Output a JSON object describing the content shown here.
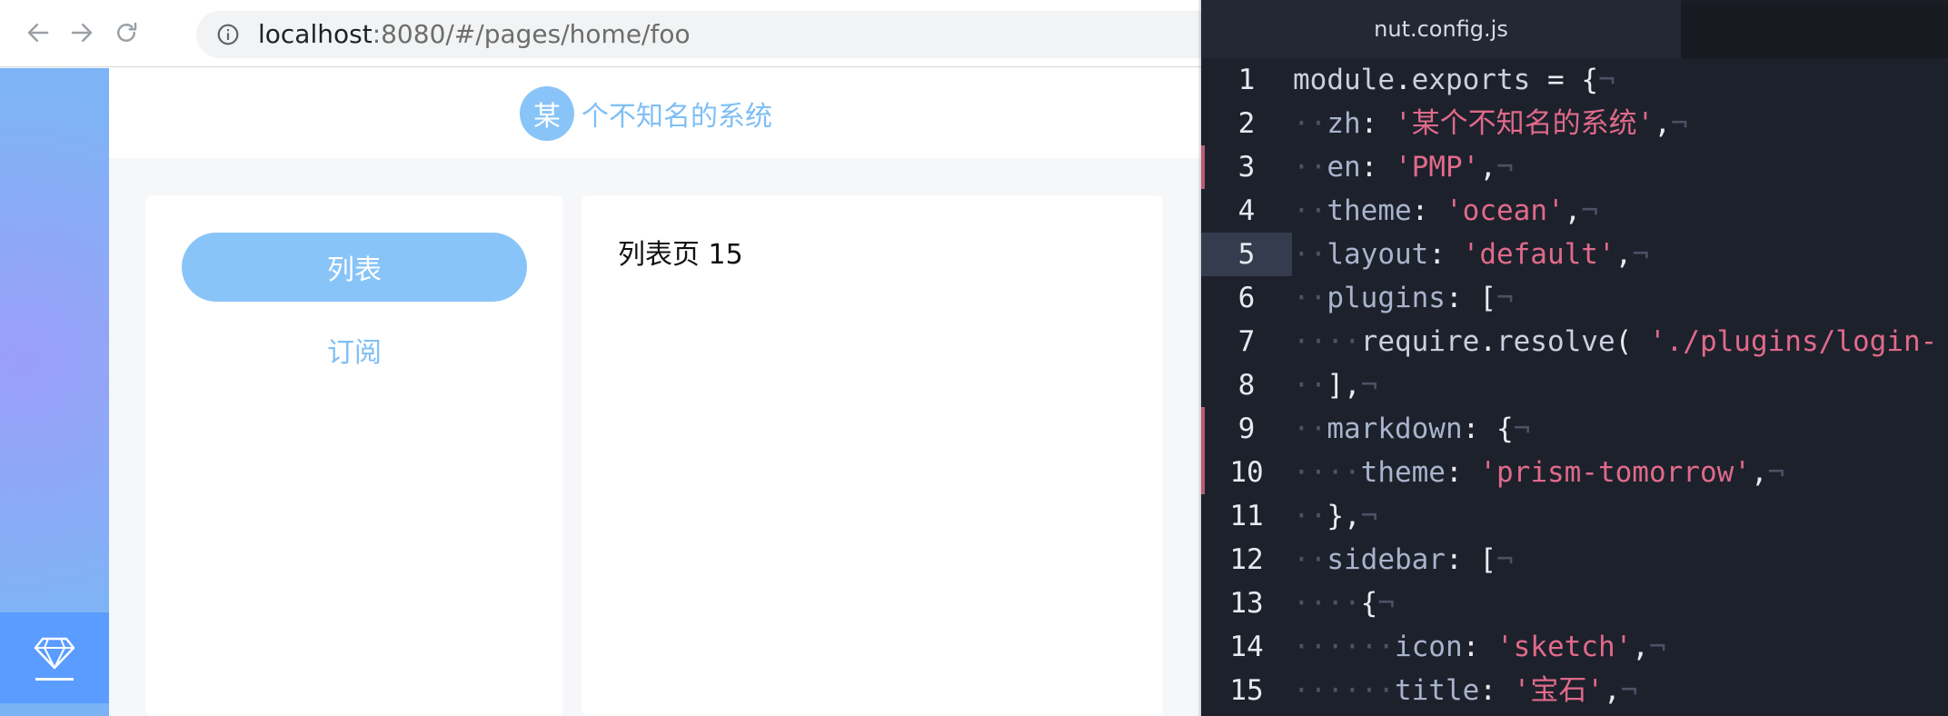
{
  "browser": {
    "url": {
      "host": "localhost",
      "path": ":8080/#/pages/home/foo"
    },
    "nav": {
      "back_icon": "arrow-left-icon",
      "forward_icon": "arrow-right-icon",
      "reload_icon": "reload-icon",
      "info_icon": "info-icon"
    }
  },
  "app": {
    "logo_char": "某",
    "title": "个不知名的系统",
    "sidebar_icon": "diamond-icon",
    "menu": {
      "active_label": "列表",
      "secondary_label": "订阅"
    },
    "content": {
      "text": "列表页 15"
    },
    "colors": {
      "accent": "#88c4f8",
      "strip_blue": "#5a9cff"
    }
  },
  "editor": {
    "tab_title": "nut.config.js",
    "lines": [
      {
        "num": "1",
        "text": "module.exports = {¬"
      },
      {
        "num": "2",
        "text": "··zh: '某个不知名的系统',¬"
      },
      {
        "num": "3",
        "text": "··en: 'PMP',¬"
      },
      {
        "num": "4",
        "text": "··theme: 'ocean',¬"
      },
      {
        "num": "5",
        "text": "··layout: 'default',¬"
      },
      {
        "num": "6",
        "text": "··plugins: [¬"
      },
      {
        "num": "7",
        "text": "····require.resolve( './plugins/login-"
      },
      {
        "num": "8",
        "text": "··],¬"
      },
      {
        "num": "9",
        "text": "··markdown: {¬"
      },
      {
        "num": "10",
        "text": "····theme: 'prism-tomorrow',¬"
      },
      {
        "num": "11",
        "text": "··},¬"
      },
      {
        "num": "12",
        "text": "··sidebar: [¬"
      },
      {
        "num": "13",
        "text": "····{¬"
      },
      {
        "num": "14",
        "text": "······icon: 'sketch',¬"
      },
      {
        "num": "15",
        "text": "······title: '宝石',¬"
      }
    ],
    "active_line": "5",
    "modified_lines": [
      "3",
      "9",
      "10"
    ],
    "colors": {
      "background": "#1d212b",
      "string": "#e06a8a",
      "key": "#a8b3cc"
    }
  }
}
